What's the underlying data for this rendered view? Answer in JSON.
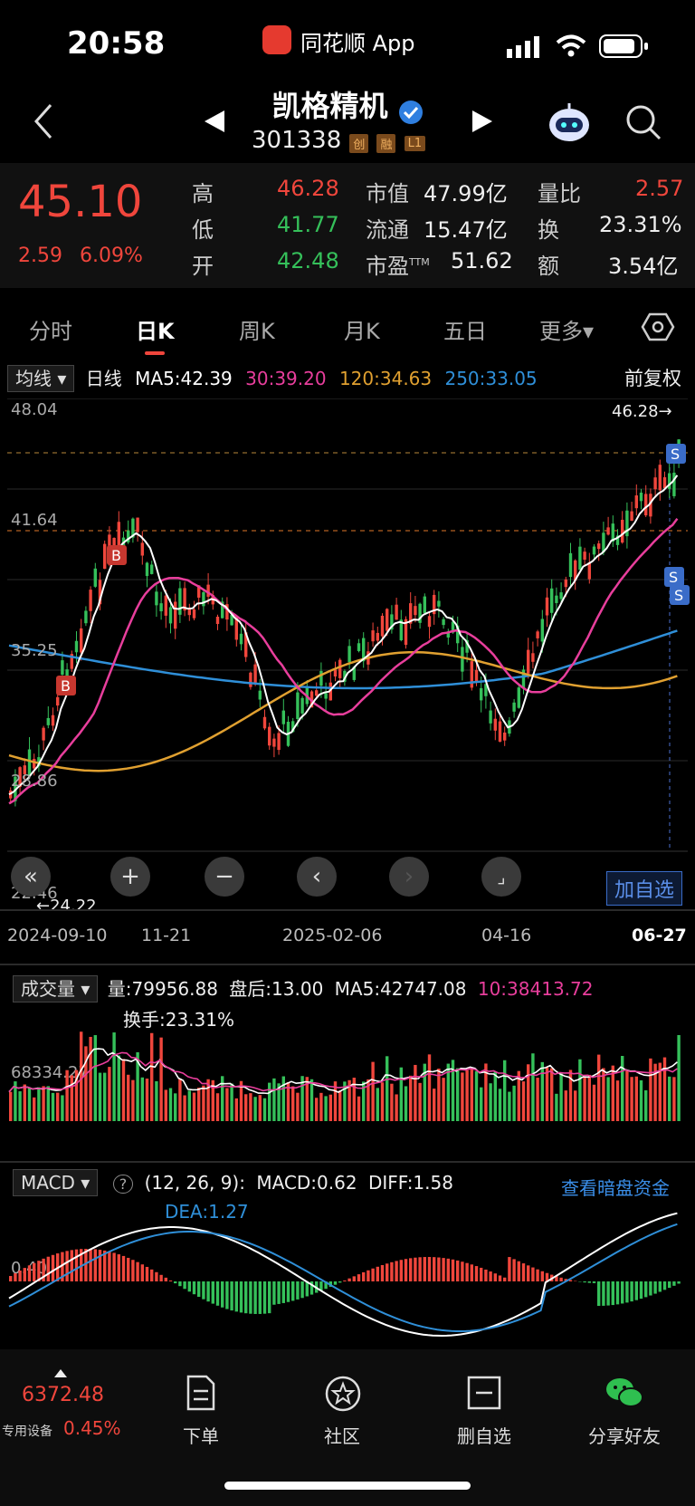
{
  "status_bar": {
    "time": "20:58",
    "app_name": "同花顺 App"
  },
  "header": {
    "title": "凯格精机",
    "code": "301338",
    "tags": [
      "创",
      "融",
      "L1"
    ]
  },
  "quote": {
    "price": "45.10",
    "change": "2.59",
    "change_pct": "6.09%",
    "high_label": "高",
    "high": "46.28",
    "low_label": "低",
    "low": "41.77",
    "open_label": "开",
    "open": "42.48",
    "mktcap_label": "市值",
    "mktcap": "47.99亿",
    "float_label": "流通",
    "float": "15.47亿",
    "pe_label": "市盈",
    "pe_sup": "TTM",
    "pe": "51.62",
    "vol_ratio_label": "量比",
    "vol_ratio": "2.57",
    "turnover_label": "换",
    "turnover": "23.31%",
    "amount_label": "额",
    "amount": "3.54亿"
  },
  "tabs": [
    "分时",
    "日K",
    "周K",
    "月K",
    "五日",
    "更多▾"
  ],
  "ma_legend": {
    "selector": "均线",
    "period": "日线",
    "ma5": "MA5:42.39",
    "ma30": "30:39.20",
    "ma120": "120:34.63",
    "ma250": "250:33.05",
    "adjust": "前复权"
  },
  "kline": {
    "y_labels": [
      "48.04",
      "41.64",
      "35.25",
      "28.86",
      "22.46"
    ],
    "high_marker": "46.28→",
    "low_marker": "←24.22",
    "x_labels": [
      "2024-09-10",
      "11-21",
      "2025-02-06",
      "04-16",
      "06-27"
    ],
    "add_watch": "加自选"
  },
  "volume": {
    "selector": "成交量",
    "vol": "量:79956.88",
    "after": "盘后:13.00",
    "ma5": "MA5:42747.08",
    "ma10": "10:38413.72",
    "turnover": "换手:23.31%",
    "y_label": "68334.27"
  },
  "macd": {
    "selector": "MACD",
    "params": "(12, 26, 9):",
    "macd": "MACD:0.62",
    "diff": "DIFF:1.58",
    "dea": "DEA:1.27",
    "link": "查看暗盘资金",
    "y_label": "0.40"
  },
  "bottom_nav": {
    "index_value": "6372.48",
    "index_device": "专用设备",
    "index_pct": "0.45%",
    "order": "下单",
    "community": "社区",
    "remove_watch": "删自选",
    "share": "分享好友"
  },
  "colors": {
    "up": "#f0463c",
    "down": "#35c05a",
    "ma5": "#ffffff",
    "ma30": "#e83e9c",
    "ma120": "#e0a030",
    "ma250": "#2f8fd8"
  }
}
